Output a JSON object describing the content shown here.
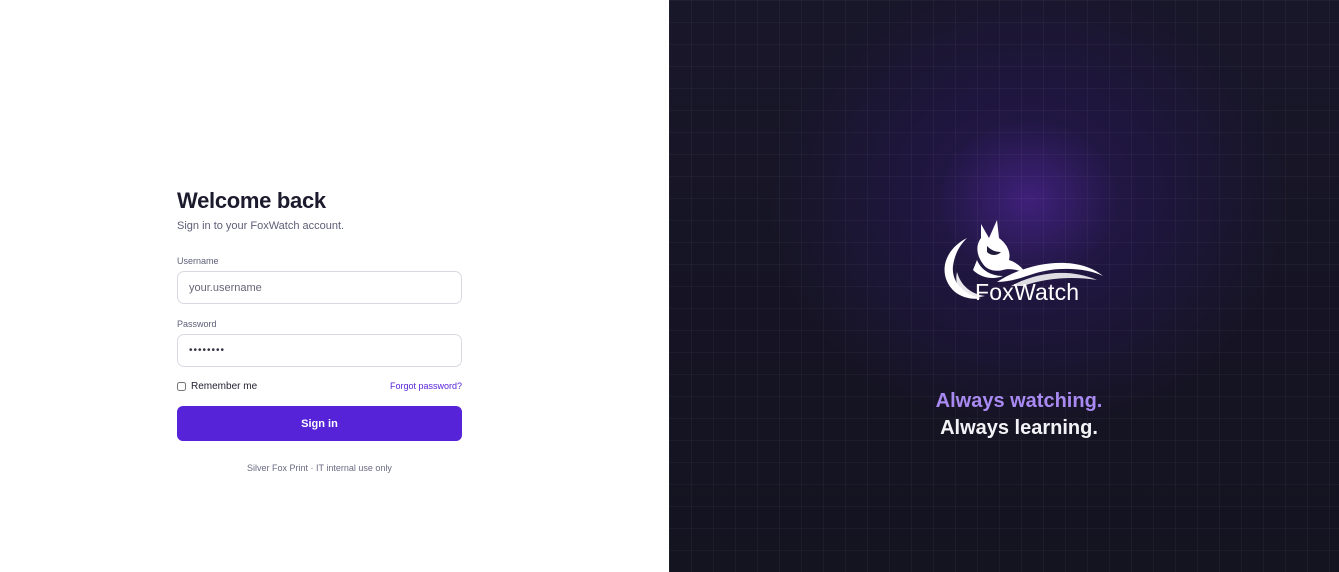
{
  "login": {
    "title": "Welcome back",
    "subtitle": "Sign in to your FoxWatch account.",
    "username_label": "Username",
    "username_placeholder": "your.username",
    "password_label": "Password",
    "password_value": "••••••••",
    "remember_label": "Remember me",
    "remember_checked": false,
    "forgot_label": "Forgot password?",
    "signin_label": "Sign in",
    "footer_note": "Silver Fox Print · IT internal use only"
  },
  "brand": {
    "name": "FoxWatch",
    "logo_icon": "fox-icon",
    "tagline_line1": "Always watching.",
    "tagline_line2": "Always learning."
  },
  "colors": {
    "accent": "#5623d8",
    "tagline_accent": "#a98af2",
    "panel_dark": "#161524"
  }
}
